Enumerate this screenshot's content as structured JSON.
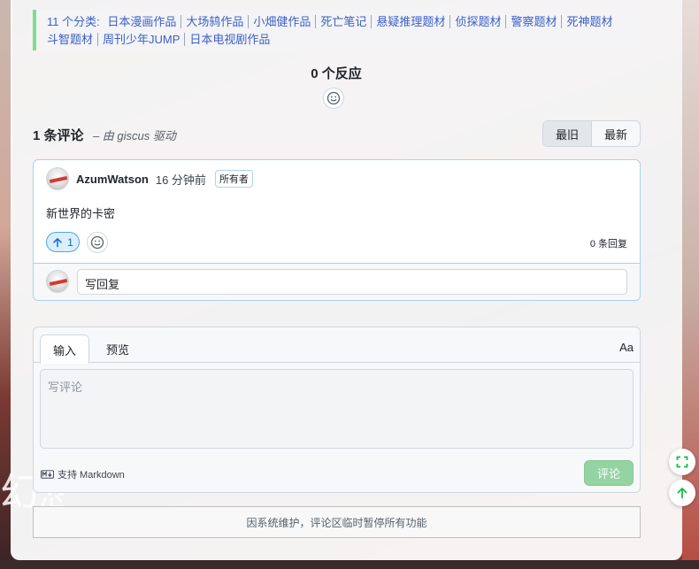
{
  "categories": {
    "prefix": "11 个分类:",
    "items": [
      "日本漫画作品",
      "大场鸫作品",
      "小畑健作品",
      "死亡笔记",
      "悬疑推理题材",
      "侦探题材",
      "警察题材",
      "死神题材",
      "斗智题材",
      "周刊少年JUMP",
      "日本电视剧作品"
    ]
  },
  "reactions": {
    "title": "0 个反应",
    "button_icon": "smiley-icon"
  },
  "comments": {
    "count_label": "1 条评论",
    "powered_by": "– 由 giscus 驱动",
    "sort": {
      "oldest": "最旧",
      "newest": "最新",
      "selected": "最旧"
    }
  },
  "comment": {
    "author": "AzumWatson",
    "time": "16 分钟前",
    "badge": "所有者",
    "body": "新世界的卡密",
    "upvotes": "1",
    "reply_count": "0 条回复",
    "reply_placeholder": "写回复"
  },
  "editor": {
    "tab_write": "输入",
    "tab_preview": "预览",
    "font_toggle": "Aa",
    "placeholder": "写评论",
    "markdown_hint": "支持 Markdown",
    "submit": "评论"
  },
  "maintenance_notice": "因系统维护，评论区临时暂停所有功能",
  "background_text": "幻想",
  "colors": {
    "link": "#3b5fc7",
    "accent_green": "#7ddf8c",
    "upvote_blue": "#0969da",
    "submit_disabled": "#94d3a2"
  }
}
